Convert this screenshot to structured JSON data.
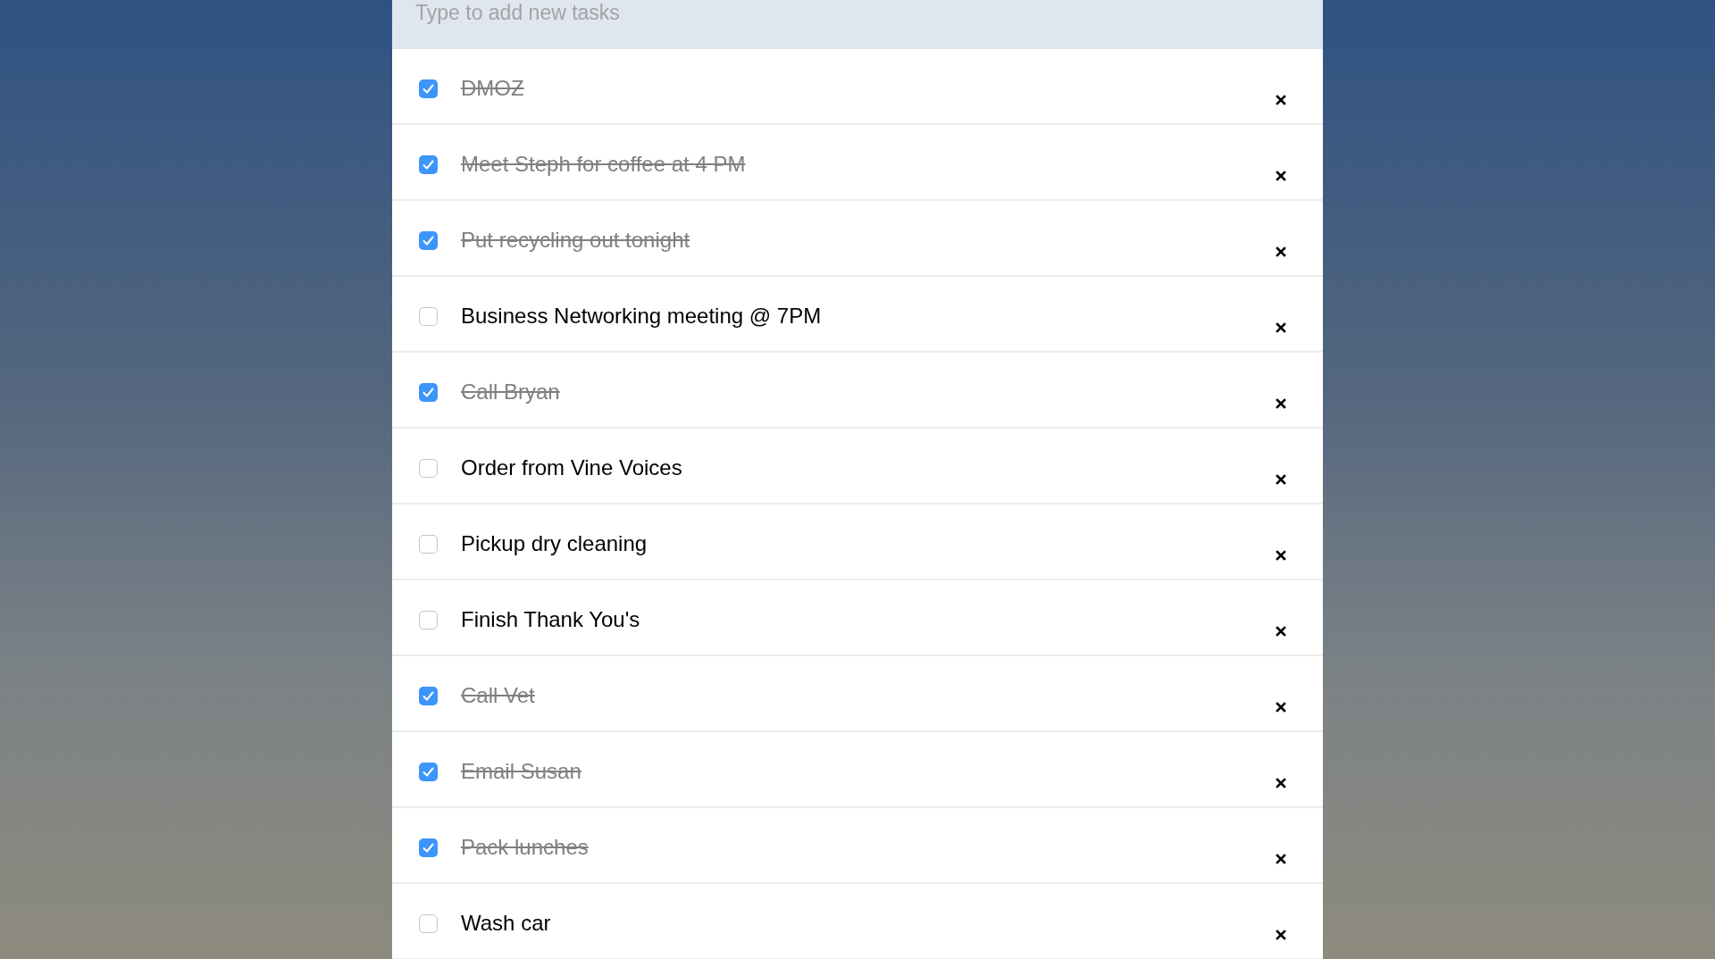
{
  "new_task": {
    "placeholder": "Type to add new tasks"
  },
  "tasks": [
    {
      "label": "DMOZ",
      "checked": true
    },
    {
      "label": "Meet Steph for coffee at 4 PM",
      "checked": true
    },
    {
      "label": "Put recycling out tonight",
      "checked": true
    },
    {
      "label": "Business Networking meeting @ 7PM",
      "checked": false
    },
    {
      "label": "Call Bryan",
      "checked": true
    },
    {
      "label": "Order from Vine Voices",
      "checked": false
    },
    {
      "label": "Pickup dry cleaning",
      "checked": false
    },
    {
      "label": "Finish Thank You's",
      "checked": false
    },
    {
      "label": "Call Vet",
      "checked": true
    },
    {
      "label": "Email Susan",
      "checked": true
    },
    {
      "label": "Pack lunches",
      "checked": true
    },
    {
      "label": "Wash car",
      "checked": false
    }
  ]
}
